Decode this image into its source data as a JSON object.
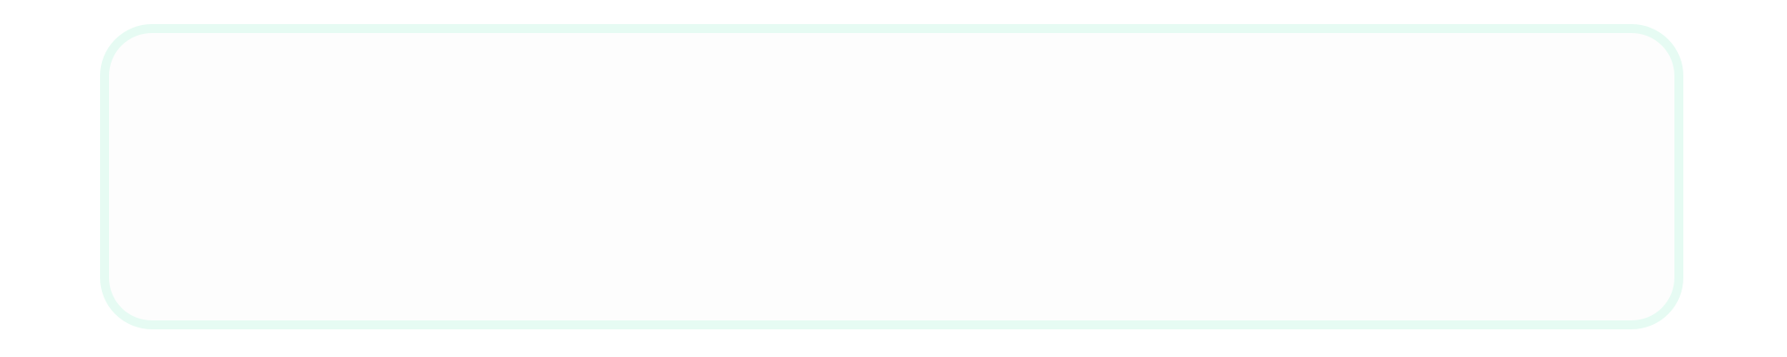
{
  "card": {
    "border_color": "#e6fbf3",
    "fill_color": "#fdfdfd"
  }
}
